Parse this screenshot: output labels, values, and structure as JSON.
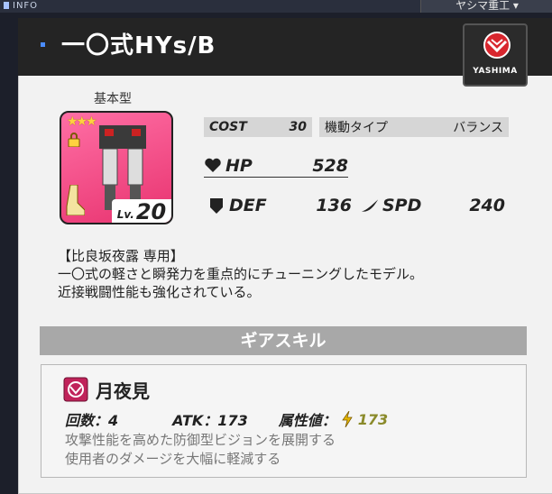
{
  "header": {
    "info_label": "INFO",
    "maker_tab": "ヤシマ重工 ▾"
  },
  "unit": {
    "name": "一〇式HYs/B",
    "maker_name": "YASHIMA",
    "type_label": "基本型",
    "stars": "★★★",
    "level_label": "Lv.",
    "level": "20",
    "cost_label": "COST",
    "cost": "30",
    "mobility_label": "機動タイプ",
    "mobility": "バランス",
    "hp_label": "HP",
    "hp": "528",
    "def_label": "DEF",
    "def": "136",
    "spd_label": "SPD",
    "spd": "240",
    "description": [
      "【比良坂夜露 専用】",
      "一〇式の軽さと瞬発力を重点的にチューニングしたモデル。",
      "近接戦闘性能も強化されている。"
    ]
  },
  "gear_skill": {
    "section_title": "ギアスキル",
    "name": "月夜見",
    "count_text": "回数：4",
    "atk_text": "ATK：173",
    "attr_label": "属性値：",
    "attr_value": "173",
    "description": [
      "攻撃性能を高めた防御型ビジョンを展開する",
      "使用者のダメージを大幅に軽減する"
    ]
  },
  "colors": {
    "card_pink": "#ff6fa5",
    "star": "#ffd23f",
    "maker_red": "#d8262e",
    "attr_value": "#8a8a2a"
  }
}
